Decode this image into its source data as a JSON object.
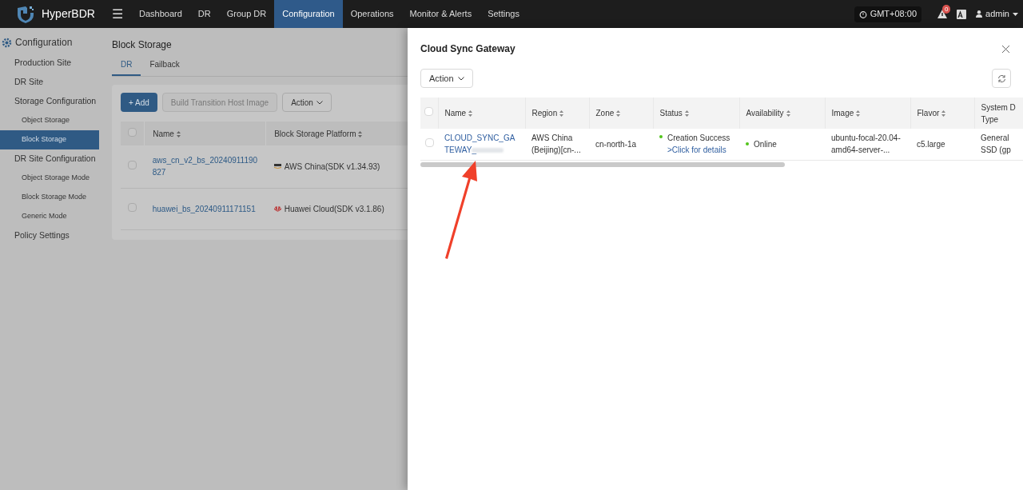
{
  "topbar": {
    "brand": "HyperBDR",
    "menu_icon": "☰",
    "nav": [
      {
        "label": "Dashboard",
        "selected": false
      },
      {
        "label": "DR",
        "selected": false
      },
      {
        "label": "Group DR",
        "selected": false
      },
      {
        "label": "Configuration",
        "selected": true
      },
      {
        "label": "Operations",
        "selected": false
      },
      {
        "label": "Monitor & Alerts",
        "selected": false
      },
      {
        "label": "Settings",
        "selected": false
      }
    ],
    "timezone": "GMT+08:00",
    "alert_count": "0",
    "user": "admin"
  },
  "sidebar": {
    "title": "Configuration",
    "items": [
      {
        "label": "Production Site",
        "selected": false
      },
      {
        "label": "DR Site",
        "selected": false
      },
      {
        "label": "Storage Configuration",
        "selected": false,
        "children": [
          {
            "label": "Object Storage",
            "selected": false
          },
          {
            "label": "Block Storage",
            "selected": true
          }
        ]
      },
      {
        "label": "DR Site Configuration",
        "selected": false,
        "children": [
          {
            "label": "Object Storage Mode",
            "selected": false
          },
          {
            "label": "Block Storage Mode",
            "selected": false
          },
          {
            "label": "Generic Mode",
            "selected": false
          }
        ]
      },
      {
        "label": "Policy Settings",
        "selected": false
      }
    ]
  },
  "page": {
    "title": "Block Storage",
    "tabs": [
      {
        "label": "DR",
        "selected": true
      },
      {
        "label": "Failback",
        "selected": false
      }
    ],
    "buttons": [
      {
        "label": "+ Add",
        "kind": "primary"
      },
      {
        "label": "Build Transition Host Image",
        "kind": "disabled"
      },
      {
        "label": "Action",
        "kind": "dropdown"
      }
    ],
    "table": {
      "all_checked": false,
      "columns": [
        "Name",
        "Block Storage Platform"
      ],
      "rows": [
        {
          "checked": false,
          "name": "aws_cn_v2_bs_20240911190827",
          "platform": "AWS China(SDK v1.34.93)",
          "kind": "aws"
        },
        {
          "checked": false,
          "name": "huawei_bs_20240911171151",
          "platform": "Huawei Cloud(SDK v3.1.86)",
          "kind": "huawei"
        }
      ]
    }
  },
  "drawer": {
    "title": "Cloud Sync Gateway",
    "action": "Action",
    "table": {
      "all_checked": false,
      "columns": [
        "Name",
        "Region",
        "Zone",
        "Status",
        "Availability",
        "Image",
        "Flavor",
        "System D Type"
      ],
      "rows": [
        {
          "checked": false,
          "name": "CLOUD_SYNC_GATEWAY_",
          "region": "AWS China (Beijing)[cn-...",
          "zone": "cn-north-1a",
          "status": {
            "text": "Creation Success",
            "color": "#52c41a",
            "link": ">Click for details"
          },
          "availability": {
            "text": "Online",
            "color": "#52c41a"
          },
          "image": "ubuntu-focal-20.04-amd64-server-...",
          "flavor": "c5.large",
          "system_disk_type": "General SSD (gp"
        }
      ]
    }
  }
}
